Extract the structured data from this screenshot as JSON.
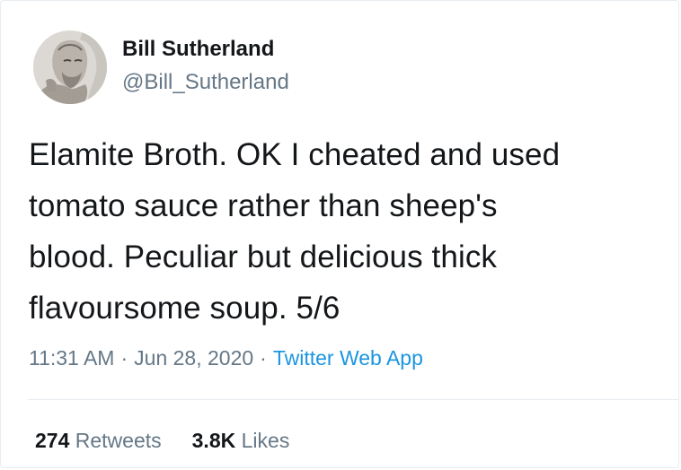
{
  "author": {
    "display_name": "Bill Sutherland",
    "handle": "@Bill_Sutherland",
    "avatar_icon": "profile-photo-avatar"
  },
  "tweet": {
    "lines": [
      "Elamite Broth. OK I cheated and used",
      "tomato sauce rather than sheep's",
      "blood. Peculiar but delicious thick",
      "flavoursome soup. 5/6"
    ]
  },
  "meta": {
    "time": "11:31 AM",
    "separator": "·",
    "date": "Jun 28, 2020",
    "source": "Twitter Web App"
  },
  "stats": {
    "retweets_count": "274",
    "retweets_label": "Retweets",
    "likes_count": "3.8K",
    "likes_label": "Likes"
  },
  "colors": {
    "text": "#14171a",
    "secondary": "#657786",
    "link": "#1b95e0",
    "border": "#e6ecf0"
  }
}
